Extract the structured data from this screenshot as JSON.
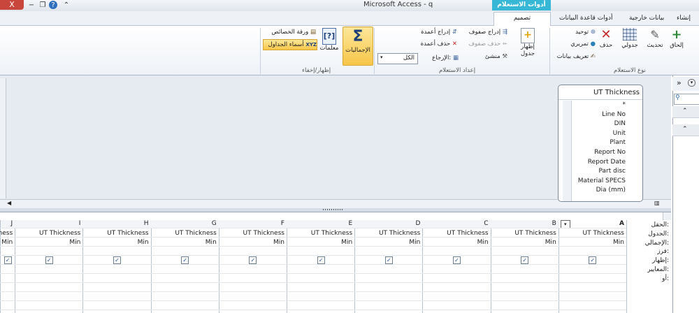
{
  "window": {
    "title": "Microsoft Access - q",
    "contextual_tab": "أدوات الاستعلام",
    "close": "X",
    "minimize": "−",
    "restore": "❐",
    "help": "?",
    "collapse": "⌃"
  },
  "tabs": [
    {
      "label": "تصميم"
    },
    {
      "label": "أدوات قاعدة البيانات"
    },
    {
      "label": "بيانات خارجية"
    },
    {
      "label": "إنشاء"
    }
  ],
  "ribbon": {
    "query_type": {
      "label": "نوع الاستعلام",
      "append": "إلحاق",
      "update": "تحديث",
      "crosstab": "جدولي",
      "delete": "حذف",
      "union": "توحيد",
      "passthrough": "تمريري",
      "data_definition": "تعريف بيانات"
    },
    "query_setup": {
      "label": "إعداد الاستعلام",
      "show_table": "إظهار جدول",
      "insert_rows": "إدراج صفوف",
      "delete_rows": "حذف صفوف",
      "builder": "منشئ",
      "insert_columns": "إدراج أعمدة",
      "delete_columns": "حذف أعمدة",
      "return_label": "الإرجاع:",
      "return_value": "الكل"
    },
    "show_hide": {
      "label": "إظهار/إخفاء",
      "totals": "الإجماليات",
      "parameters": "معلمات",
      "property_sheet": "ورقة الخصائص",
      "table_names": "أسماء الجداول"
    }
  },
  "field_list": {
    "title": "UT Thickness",
    "items": [
      "*",
      "Line No",
      "DIN",
      "Unit",
      "Plant",
      "Report No",
      "Report Date",
      "Part disc",
      "Material SPECS",
      "Dia (mm)"
    ]
  },
  "grid": {
    "row_labels": [
      "الحقل:",
      "الجدول:",
      "الإجمالي:",
      "فرز:",
      "إظهار:",
      "المعايير:",
      "أو:"
    ],
    "columns": [
      {
        "letter": "A",
        "table": "UT Thickness",
        "total": "Min"
      },
      {
        "letter": "B",
        "table": "UT Thickness",
        "total": "Min"
      },
      {
        "letter": "C",
        "table": "UT Thickness",
        "total": "Min"
      },
      {
        "letter": "D",
        "table": "UT Thickness",
        "total": "Min"
      },
      {
        "letter": "E",
        "table": "UT Thickness",
        "total": "Min"
      },
      {
        "letter": "F",
        "table": "UT Thickness",
        "total": "Min"
      },
      {
        "letter": "G",
        "table": "UT Thickness",
        "total": "Min"
      },
      {
        "letter": "H",
        "table": "UT Thickness",
        "total": "Min"
      },
      {
        "letter": "I",
        "table": "UT Thickness",
        "total": "Min"
      },
      {
        "letter": "J",
        "table": "hickness",
        "total": "Min"
      }
    ]
  },
  "nav": {
    "expand": "»",
    "menu": "▾"
  }
}
